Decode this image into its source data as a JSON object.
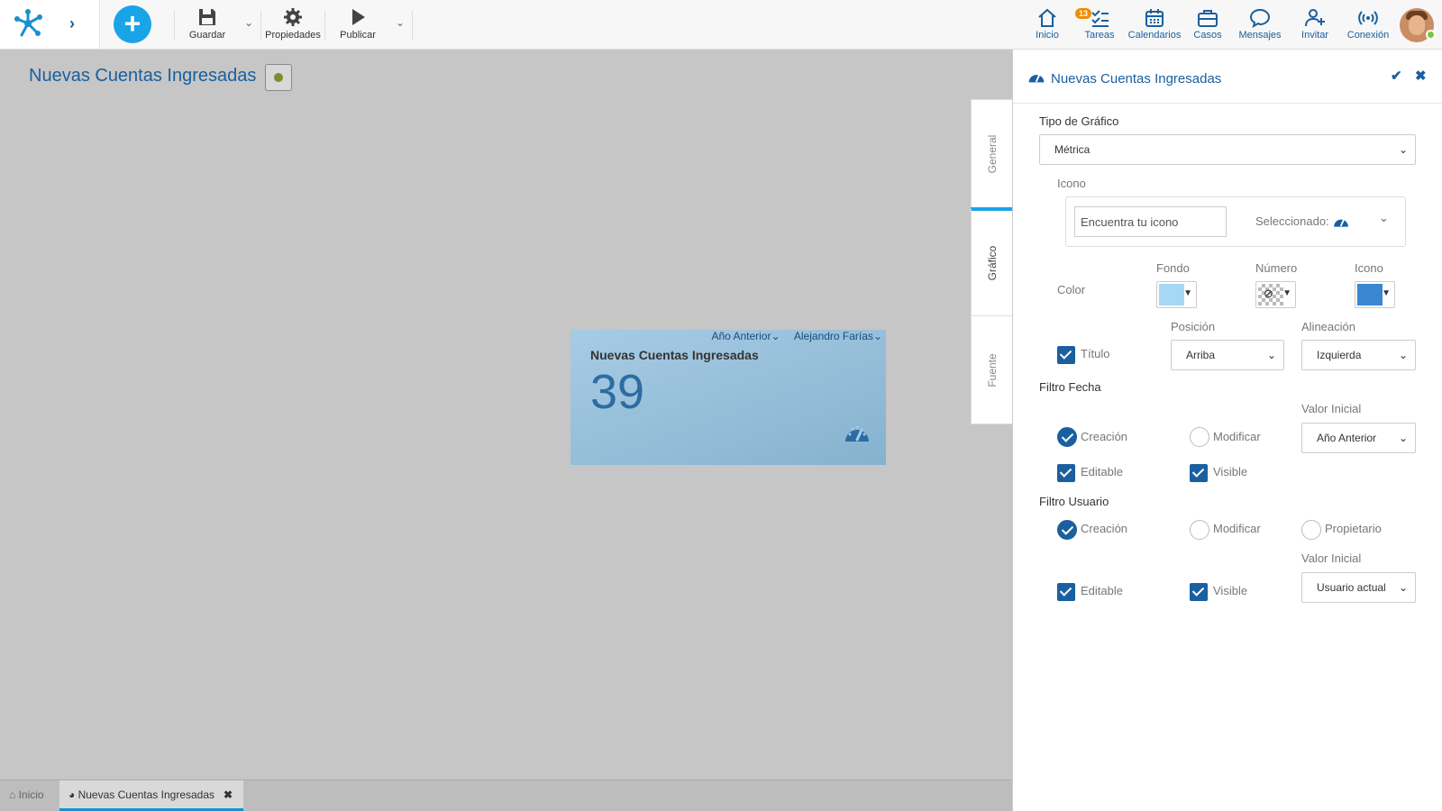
{
  "toolbar": {
    "save_label": "Guardar",
    "properties_label": "Propiedades",
    "publish_label": "Publicar"
  },
  "nav": {
    "home": "Inicio",
    "tasks": "Tareas",
    "tasks_badge": "13",
    "calendars": "Calendarios",
    "cases": "Casos",
    "messages": "Mensajes",
    "invite": "Invitar",
    "connection": "Conexión"
  },
  "page": {
    "title": "Nuevas Cuentas Ingresadas"
  },
  "widget": {
    "filter_date": "Año Anterior",
    "filter_user": "Alejandro Farías",
    "title": "Nuevas Cuentas Ingresadas",
    "value": "39"
  },
  "vtabs": {
    "general": "General",
    "chart": "Gráfico",
    "source": "Fuente"
  },
  "panel": {
    "title": "Nuevas Cuentas Ingresadas",
    "chart_type_label": "Tipo de Gráfico",
    "chart_type_value": "Métrica",
    "icon_label": "Icono",
    "icon_search_placeholder": "Encuentra tu icono",
    "selected_label": "Seleccionado:",
    "color_label": "Color",
    "background_label": "Fondo",
    "number_label": "Número",
    "icon_color_label": "Icono",
    "colors": {
      "background": "#a6d8f5",
      "icon": "#3a86d0"
    },
    "title_check_label": "Título",
    "position_label": "Posición",
    "position_value": "Arriba",
    "alignment_label": "Alineación",
    "alignment_value": "Izquierda",
    "date_filter": {
      "heading": "Filtro Fecha",
      "initial_value_label": "Valor Inicial",
      "initial_value": "Año Anterior",
      "creation": "Creación",
      "modify": "Modificar",
      "editable": "Editable",
      "visible": "Visible"
    },
    "user_filter": {
      "heading": "Filtro Usuario",
      "creation": "Creación",
      "modify": "Modificar",
      "owner": "Propietario",
      "initial_value_label": "Valor Inicial",
      "initial_value": "Usuario actual",
      "editable": "Editable",
      "visible": "Visible"
    }
  },
  "bottom_tabs": {
    "home": "Inicio",
    "current": "Nuevas Cuentas Ingresadas"
  }
}
